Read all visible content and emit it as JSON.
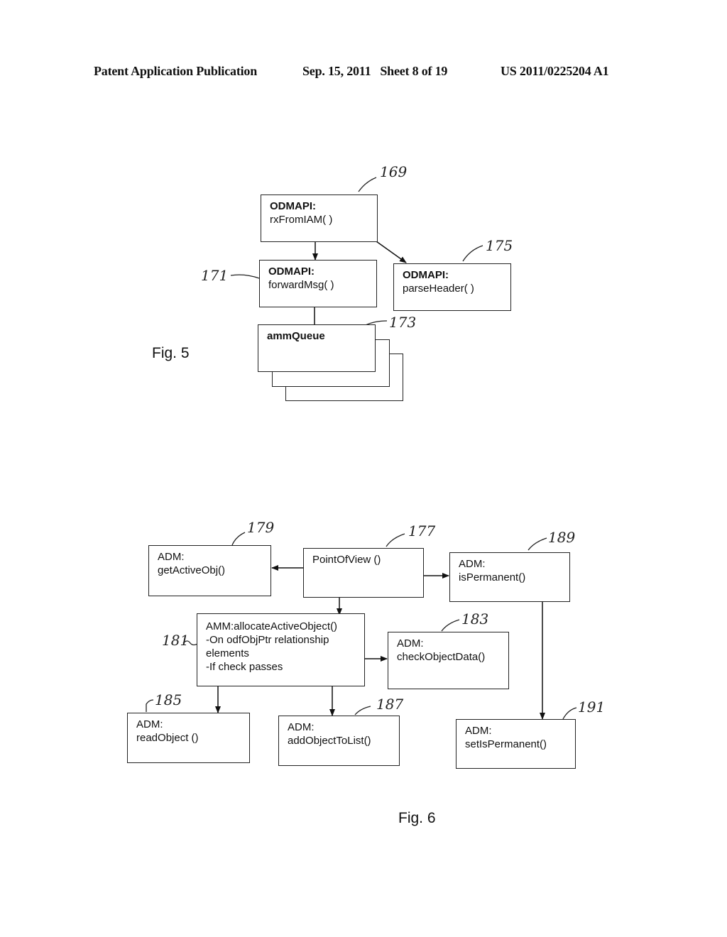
{
  "header": {
    "publication": "Patent Application Publication",
    "date_sheet": "Sep. 15, 2011   Sheet 8 of 19",
    "number": "US 2011/0225204 A1"
  },
  "fig5": {
    "caption": "Fig. 5",
    "boxes": {
      "rx": {
        "ref": "169",
        "title": "ODMAPI:",
        "method": "rxFromIAM( )"
      },
      "forward": {
        "ref": "171",
        "title": "ODMAPI:",
        "method": "forwardMsg( )"
      },
      "parse": {
        "ref": "175",
        "title": "ODMAPI:",
        "method": "parseHeader( )"
      },
      "queue": {
        "ref": "173",
        "title": "ammQueue"
      }
    }
  },
  "fig6": {
    "caption": "Fig. 6",
    "boxes": {
      "pov": {
        "ref": "177",
        "line1": "PointOfView ()"
      },
      "getactive": {
        "ref": "179",
        "line1": "ADM:",
        "line2": "getActiveObj()"
      },
      "ispermanent": {
        "ref": "189",
        "line1": "ADM:",
        "line2": "isPermanent()"
      },
      "allocate": {
        "ref": "181",
        "line1": "AMM:allocateActiveObject()",
        "line2": "-On odfObjPtr relationship",
        "line3": "elements",
        "line4": "-If check passes"
      },
      "checkdata": {
        "ref": "183",
        "line1": "ADM:",
        "line2": "checkObjectData()"
      },
      "readobject": {
        "ref": "185",
        "line1": "ADM:",
        "line2": "readObject ()"
      },
      "addobject": {
        "ref": "187",
        "line1": "ADM:",
        "line2": "addObjectToList()"
      },
      "setpermanent": {
        "ref": "191",
        "line1": "ADM:",
        "line2": "setIsPermanent()"
      }
    }
  }
}
